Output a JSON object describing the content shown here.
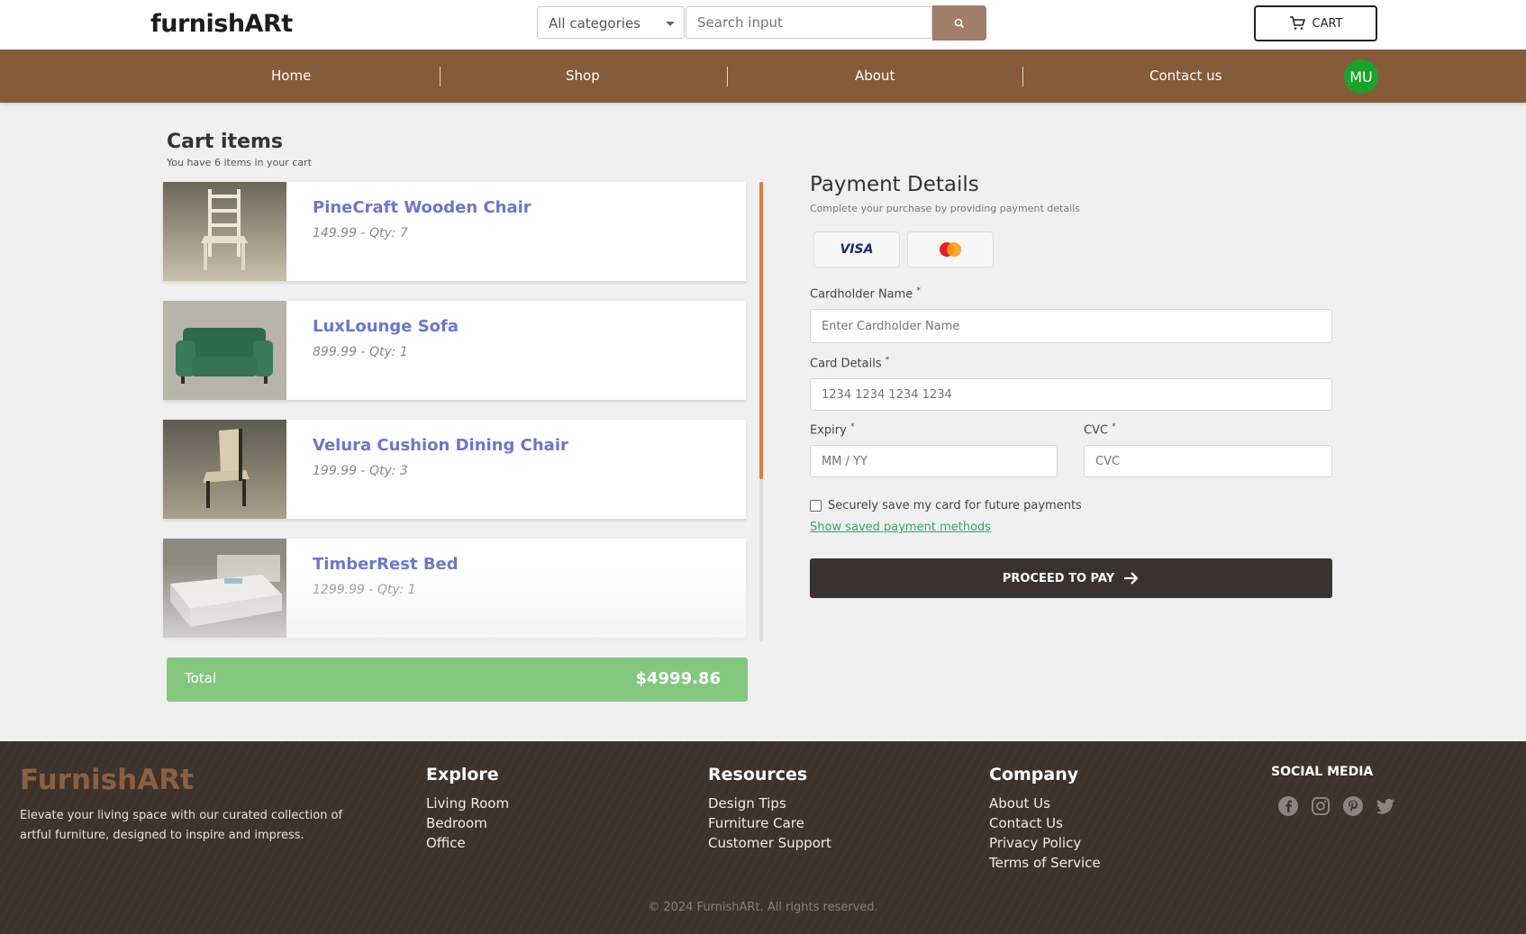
{
  "header": {
    "logo": "furnishARt",
    "category_select": "All categories",
    "search_placeholder": "Search input",
    "cart_label": "CART"
  },
  "nav": {
    "items": [
      "Home",
      "Shop",
      "About",
      "Contact us"
    ],
    "avatar_initials": "MU",
    "avatar_color": "#1aa32b",
    "bar_color": "#855b39"
  },
  "cart": {
    "title": "Cart items",
    "subtitle": "You have 6 items in your cart",
    "items": [
      {
        "name": "PineCraft Wooden Chair",
        "meta": "149.99 - Qty: 7"
      },
      {
        "name": "LuxLounge Sofa",
        "meta": "899.99 - Qty: 1"
      },
      {
        "name": "Velura Cushion Dining Chair",
        "meta": "199.99 - Qty: 3"
      },
      {
        "name": "TimberRest Bed",
        "meta": "1299.99 - Qty: 1"
      }
    ],
    "total_label": "Total",
    "total_value": "$4999.86"
  },
  "payment": {
    "title": "Payment Details",
    "subtitle": "Complete your purchase by providing payment details",
    "visa_label": "VISA",
    "cardholder_label": "Cardholder Name",
    "cardholder_placeholder": "Enter Cardholder Name",
    "card_label": "Card Details",
    "card_placeholder": "1234 1234 1234 1234",
    "expiry_label": "Expiry",
    "expiry_placeholder": "MM / YY",
    "cvc_label": "CVC",
    "cvc_placeholder": "CVC",
    "required_mark": "*",
    "save_card_label": "Securely save my card for future payments",
    "saved_methods_link": "Show saved payment methods",
    "pay_button": "PROCEED TO PAY"
  },
  "footer": {
    "brand": "FurnishARt",
    "tagline": "Elevate your living space with our curated collection of artful furniture, designed to inspire and impress.",
    "explore": {
      "heading": "Explore",
      "links": [
        "Living Room",
        "Bedroom",
        "Office"
      ]
    },
    "resources": {
      "heading": "Resources",
      "links": [
        "Design Tips",
        "Furniture Care",
        "Customer Support"
      ]
    },
    "company": {
      "heading": "Company",
      "links": [
        "About Us",
        "Contact Us",
        "Privacy Policy",
        "Terms of Service"
      ]
    },
    "social_heading": "SOCIAL MEDIA",
    "social_icons": [
      "facebook-icon",
      "instagram-icon",
      "pinterest-icon",
      "twitter-icon"
    ],
    "copyright": "© 2024 FurnishARt. All rights reserved."
  }
}
